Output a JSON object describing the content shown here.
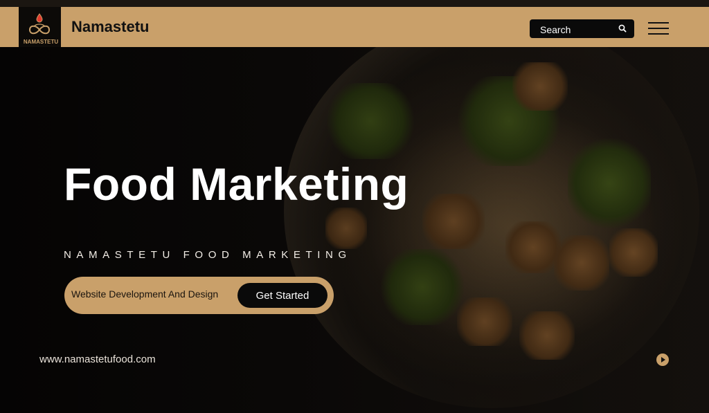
{
  "header": {
    "logo_text": "NAMASTETU",
    "brand": "Namastetu",
    "search_placeholder": "Search",
    "search_icon": "search-icon",
    "menu_icon": "hamburger-menu-icon"
  },
  "hero": {
    "title": "Food Marketing",
    "subtitle": "NAMASTETU FOOD MARKETING",
    "pill_text": "Website Development And Design",
    "cta_label": "Get Started"
  },
  "footer": {
    "url": "www.namastetufood.com",
    "play_icon": "play-icon"
  },
  "colors": {
    "accent": "#c9a06a",
    "dark": "#0a0a0a"
  }
}
